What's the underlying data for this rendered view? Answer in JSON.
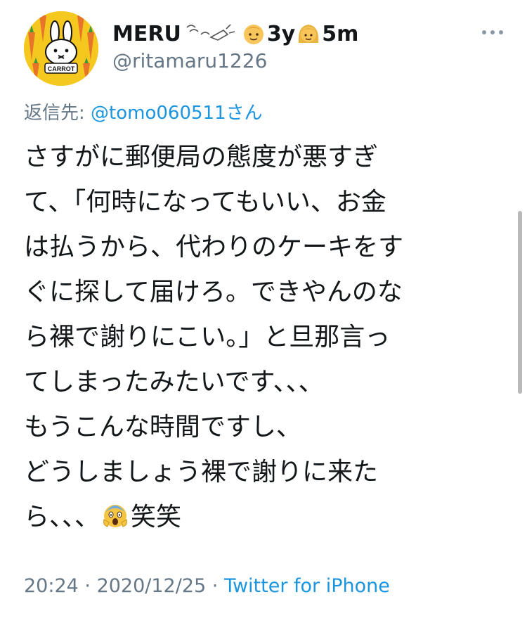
{
  "user": {
    "display_name": "MERU",
    "badge_1": "3y",
    "badge_2": "5m",
    "handle": "@ritamaru1226",
    "avatar_text": "CARROT"
  },
  "reply": {
    "prefix": "返信先: ",
    "mention": "@tomo060511さん"
  },
  "tweet": {
    "lines": [
      "さすがに郵便局の態度が悪すぎ",
      "て、「何時になってもいい、お金",
      "は払うから、代わりのケーキをす",
      "ぐに探して届けろ。できやんのな",
      "ら裸で謝りにこい。」と旦那言っ",
      "てしまったみたいです、、、",
      "もうこんな時間ですし、",
      "どうしましょう裸で謝りに来た",
      "ら、、、",
      "笑笑"
    ]
  },
  "meta": {
    "time": "20:24",
    "separator_1": " · ",
    "date": "2020/12/25",
    "separator_2": " · ",
    "source": "Twitter for iPhone"
  },
  "colors": {
    "link": "#1b95e0",
    "secondary": "#657786",
    "text": "#14171a",
    "avatar_bg": "#f4c81e"
  },
  "icons": {
    "more": "more-dots-icon",
    "scream": "face-screaming-icon",
    "boy": "boy-face-icon",
    "girl": "girl-face-icon",
    "doodle": "sparkle-doodle-icon"
  }
}
